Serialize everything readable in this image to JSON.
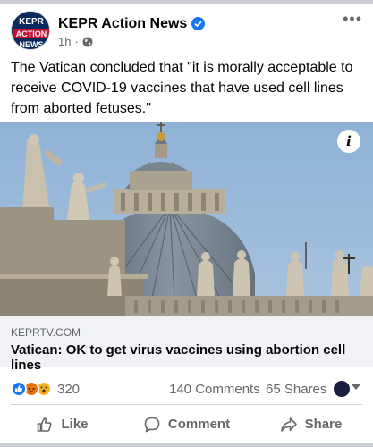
{
  "post": {
    "page_name": "KEPR Action News",
    "verified": true,
    "time": "1h",
    "privacy_icon": "globe-icon",
    "more_label": "•••",
    "text": "The Vatican concluded that \"it is morally acceptable to receive COVID-19 vaccines that have used cell lines from aborted fetuses.\""
  },
  "avatar": {
    "logo_line1": "KEPR",
    "logo_line2": "ACTION",
    "logo_line3": "NEWS"
  },
  "link_preview": {
    "info_label": "i",
    "domain": "KEPRTV.COM",
    "title": "Vatican: OK to get virus vaccines using abortion cell lines"
  },
  "stats": {
    "reactions": [
      "like",
      "angry",
      "wow"
    ],
    "reaction_count": "320",
    "comments": "140 Comments",
    "shares": "65 Shares"
  },
  "actions": {
    "like": "Like",
    "comment": "Comment",
    "share": "Share"
  },
  "colors": {
    "accent": "#1877f2",
    "secondary_text": "#65676b",
    "link_box_bg": "#f0f2f5"
  }
}
